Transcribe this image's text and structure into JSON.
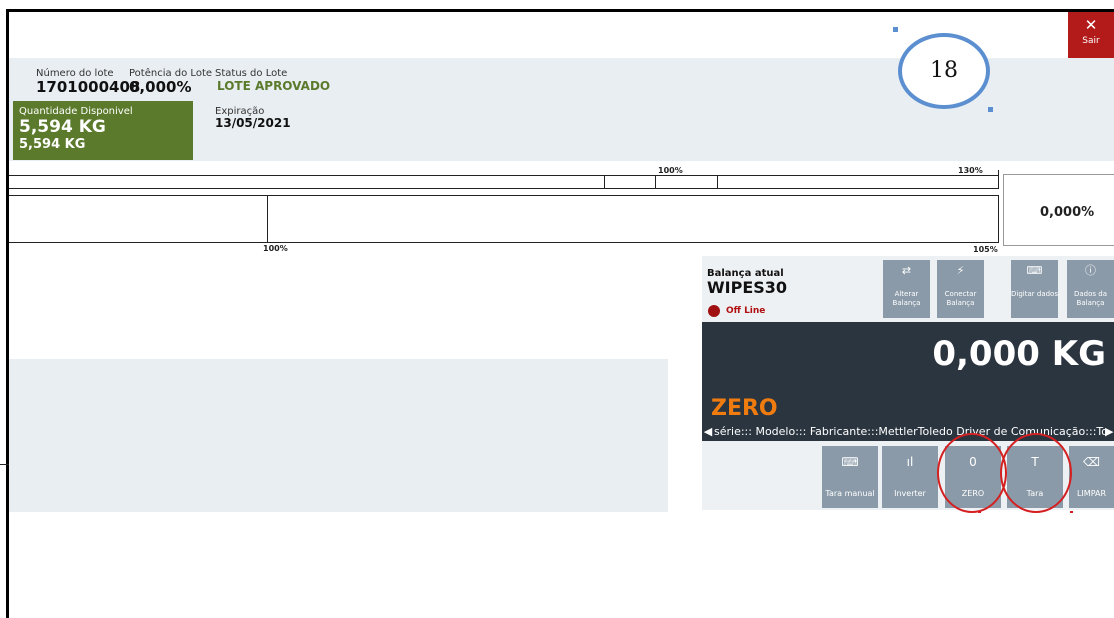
{
  "exit": {
    "icon": "✕",
    "label": "Sair"
  },
  "lot": {
    "number_label": "Número do lote",
    "number_value": "1701000408",
    "potency_label": "Potência do Lote",
    "potency_value": "0,000%",
    "status_label": "Status do Lote",
    "status_value": "LOTE APROVADO",
    "qty_label": "Quantidade Disponivel",
    "qty_value": "5,594 KG",
    "qty_value2": "5,594 KG",
    "expiry_label": "Expiração",
    "expiry_value": "13/05/2021"
  },
  "annotation": {
    "number": "18"
  },
  "gauges": {
    "top_100": "100%",
    "top_130": "130%",
    "bottom_100": "100%",
    "bottom_105": "105%",
    "side_value": "0,000%"
  },
  "scale": {
    "current_label": "Balança atual",
    "current_name": "WIPES30",
    "status": "Off Line",
    "status_color": "#b01010",
    "actions": [
      {
        "icon": "⇄",
        "label": "Alterar Balança"
      },
      {
        "icon": "⚡",
        "label": "Conectar Balança"
      },
      {
        "icon": "⌨",
        "label": "Digitar dados"
      },
      {
        "icon": "ⓘ",
        "label": "Dados da Balança"
      }
    ],
    "weight": "0,000 KG",
    "zero_label": "ZERO",
    "ticker": "série::: Modelo::: Fabricante:::MettlerToledo Driver de Comunicação:::Toledo",
    "buttons": [
      {
        "icon": "⌨",
        "label": "Tara manual"
      },
      {
        "icon": "ıl",
        "label": "Inverter"
      },
      {
        "icon": "0",
        "label": "ZERO"
      },
      {
        "icon": "T",
        "label": "Tara"
      },
      {
        "icon": "⌫",
        "label": "LIMPAR"
      }
    ],
    "accent": "#f07c10"
  }
}
